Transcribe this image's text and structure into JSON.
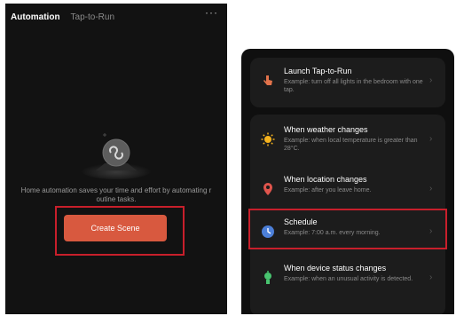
{
  "left": {
    "tabs": [
      {
        "label": "Automation"
      },
      {
        "label": "Tap-to-Run"
      }
    ],
    "more": "···",
    "empty_text": "Home automation saves your time and effort by automating r outine tasks.",
    "create_button": "Create Scene"
  },
  "right": {
    "top_card": {
      "title": "Launch Tap-to-Run",
      "subtitle": "Example: turn off all lights in the bedroom with one tap.",
      "icon": "hand-tap-icon"
    },
    "rows": [
      {
        "title": "When weather changes",
        "subtitle": "Example: when local temperature is greater than 28°C.",
        "icon": "sun-icon"
      },
      {
        "title": "When location changes",
        "subtitle": "Example: after you leave home.",
        "icon": "location-pin-icon"
      },
      {
        "title": "Schedule",
        "subtitle": "Example: 7:00 a.m. every morning.",
        "icon": "clock-icon"
      },
      {
        "title": "When device status changes",
        "subtitle": "Example: when an unusual activity is detected.",
        "icon": "device-icon"
      }
    ]
  },
  "colors": {
    "accent_button": "#d8593f",
    "highlight": "#c81f2b",
    "sun": "#f5b31e",
    "location": "#e0554d",
    "clock": "#4c7fd8",
    "device": "#48c46f"
  }
}
